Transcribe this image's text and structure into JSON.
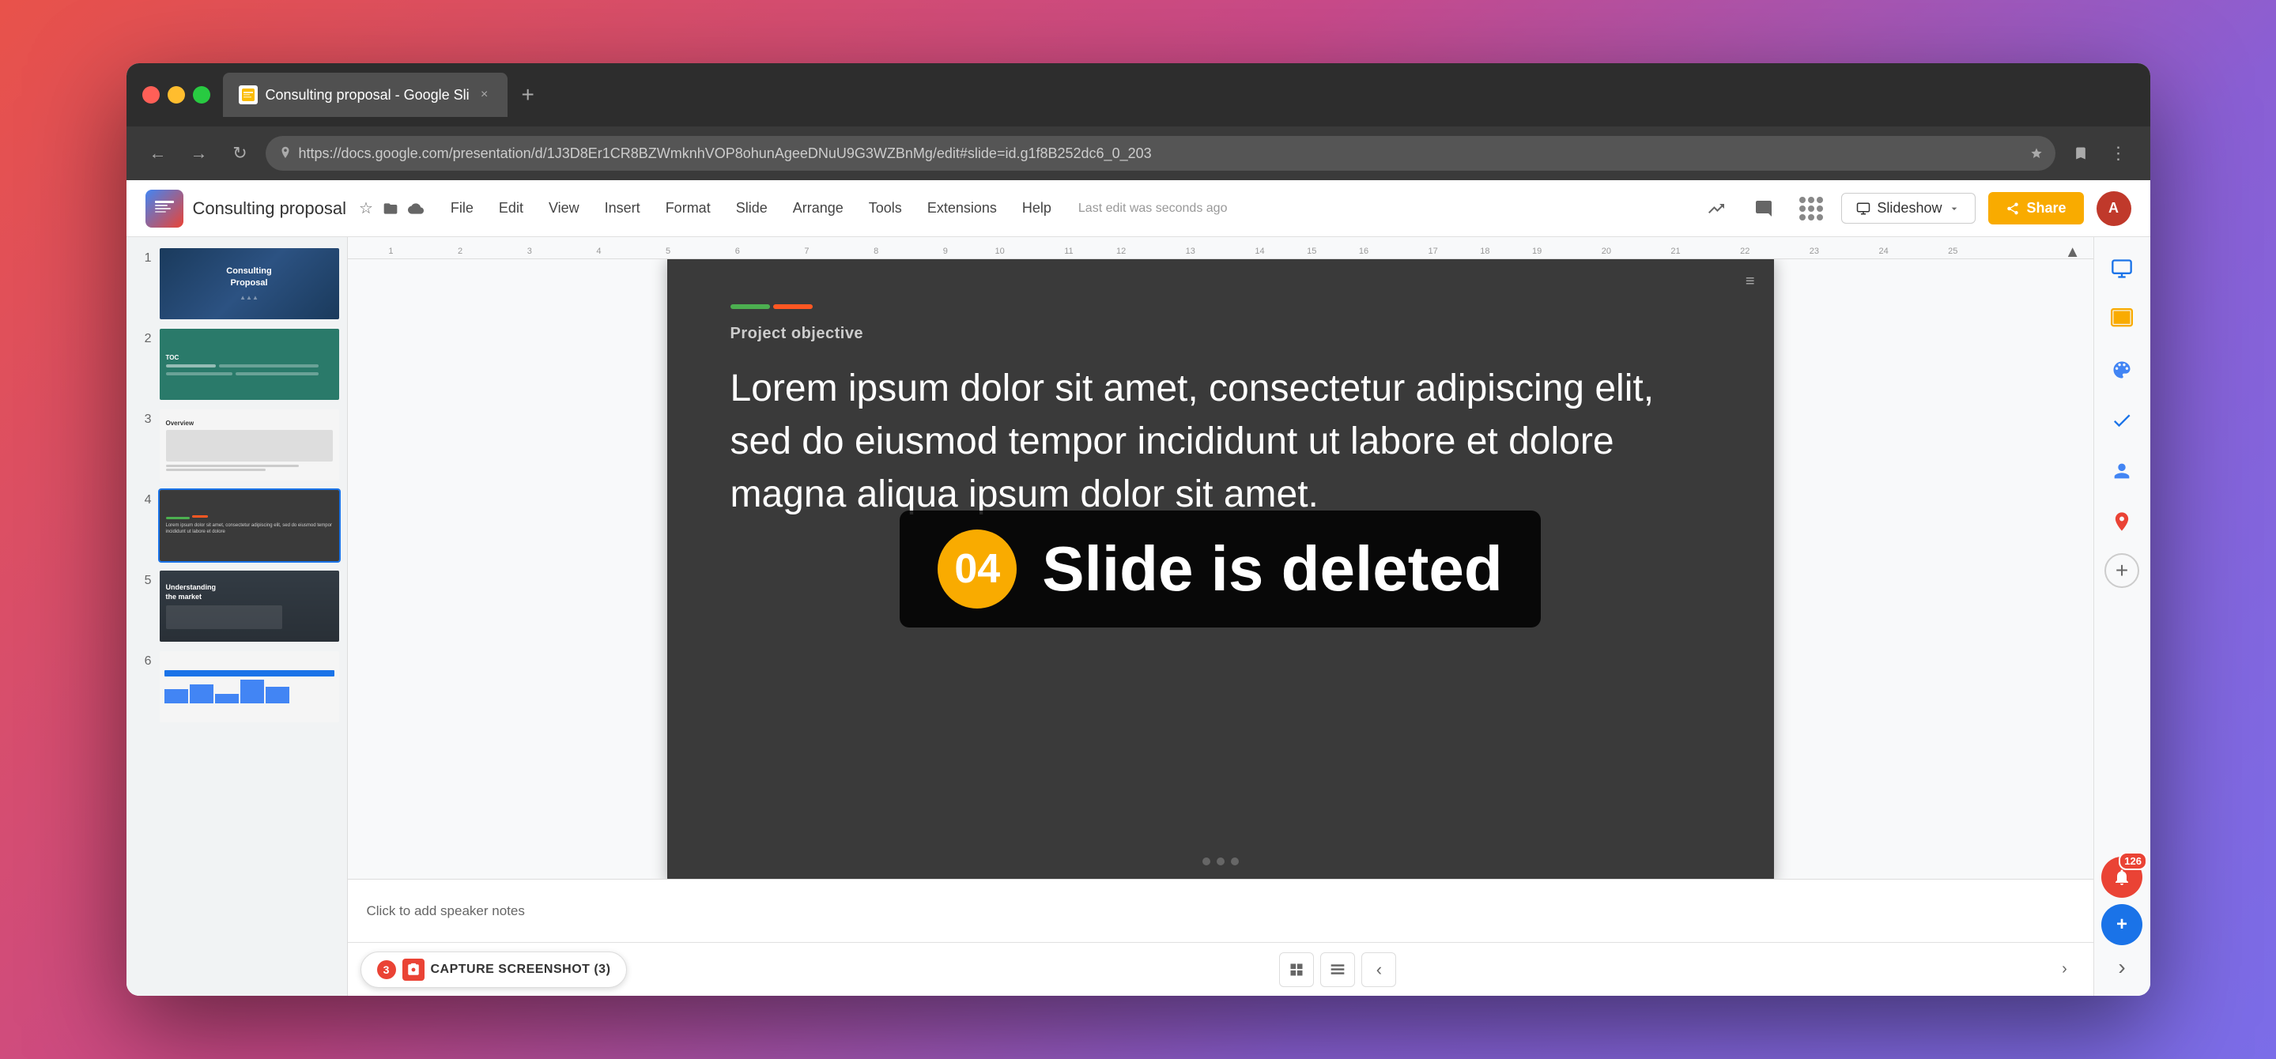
{
  "browser": {
    "tab_title": "Consulting proposal - Google Sli",
    "url": "https://docs.google.com/presentation/d/1J3D8Er1CR8BZWmknhVOP8ohunAgeeDNuU9G3WZBnMg/edit#slide=id.g1f8B252dc6_0_203",
    "new_tab_label": "+"
  },
  "app": {
    "logo_text": "📊",
    "title": "Consulting proposal",
    "last_saved": "Last edit was seconds ago",
    "menu_items": [
      "File",
      "Edit",
      "View",
      "Insert",
      "Format",
      "Slide",
      "Arrange",
      "Tools",
      "Extensions",
      "Help"
    ],
    "slideshow_label": "Slideshow",
    "share_label": "Share",
    "avatar_initials": "A"
  },
  "toast": {
    "badge_number": "04",
    "message": "Slide is deleted"
  },
  "slide": {
    "color_bar_1": "#4CAF50",
    "color_bar_2": "#FF5722",
    "section_label": "Project objective",
    "body_text": "Lorem ipsum dolor sit amet, consectetur adipiscing elit, sed do eiusmod tempor incididunt ut labore et dolore magna aliqua ipsum dolor sit amet."
  },
  "slides_panel": {
    "slides": [
      {
        "number": "1",
        "title": "Consulting Proposal"
      },
      {
        "number": "2",
        "title": "TOC"
      },
      {
        "number": "3",
        "title": "Overview"
      },
      {
        "number": "4",
        "title": "Lorem ipsum slide",
        "active": true
      },
      {
        "number": "5",
        "title": "Understanding the market"
      },
      {
        "number": "6",
        "title": "Chart slide"
      }
    ]
  },
  "speaker_notes": {
    "placeholder": "Click to add speaker notes"
  },
  "ruler": {
    "numbers": [
      "1",
      "2",
      "3",
      "4",
      "5",
      "6",
      "7",
      "8",
      "9",
      "10",
      "11",
      "12",
      "13",
      "14",
      "15",
      "16",
      "17",
      "18",
      "19",
      "20",
      "21",
      "22",
      "23",
      "24",
      "25"
    ]
  },
  "capture_btn": {
    "label": "CAPTURE SCREENSHOT (3)",
    "badge": "3"
  },
  "right_sidebar": {
    "icons": [
      "📈",
      "💬",
      "🎨",
      "✅",
      "👤",
      "📍"
    ],
    "notifications_count": "126"
  },
  "bottom": {
    "view_grid": "⊞",
    "view_list": "▦",
    "collapse": "‹"
  }
}
